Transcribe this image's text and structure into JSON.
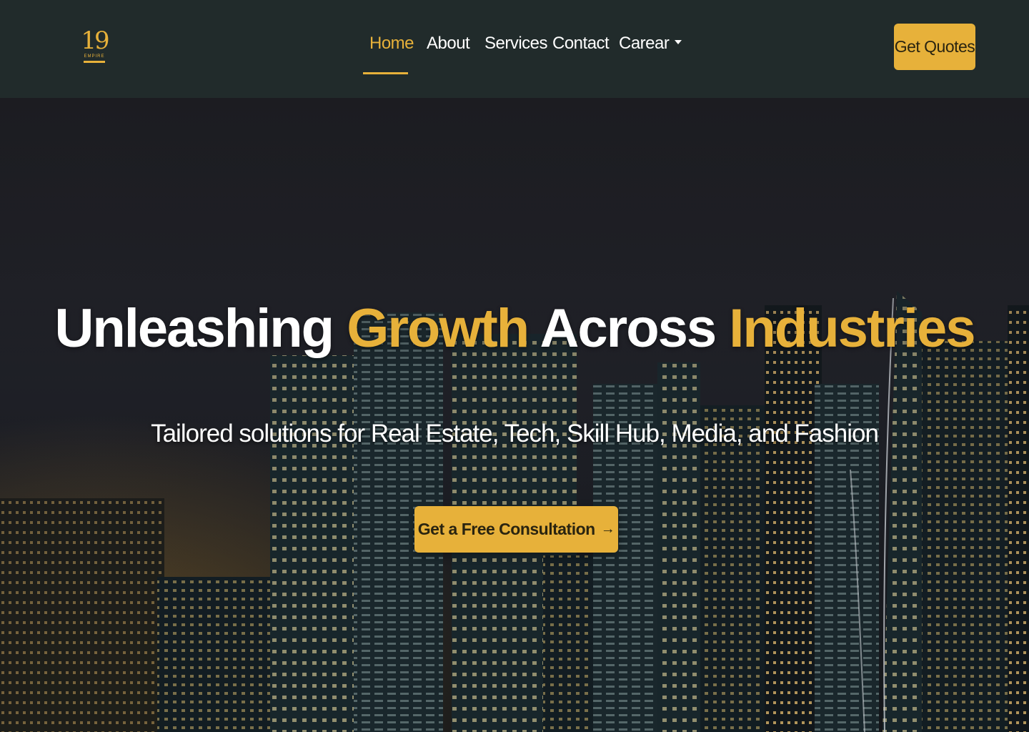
{
  "brand": {
    "logo_number": "19",
    "logo_word": "EMPIRE"
  },
  "nav": {
    "items": [
      {
        "label": "Home",
        "active": true
      },
      {
        "label": "About"
      },
      {
        "label": "Services"
      },
      {
        "label": "Contact"
      },
      {
        "label": "Carear",
        "has_dropdown": true
      }
    ],
    "quote_button": "Get Quotes"
  },
  "hero": {
    "title_parts": [
      "Unleashing ",
      "Growth",
      " Across ",
      "Industries"
    ],
    "subtitle": "Tailored solutions for Real Estate, Tech, Skill Hub, Media, and Fashion",
    "cta_label": "Get a Free Consultation",
    "cta_icon": "arrow-right-icon"
  },
  "colors": {
    "accent": "#e7b13a",
    "navbar_bg": "#212b2b",
    "text": "#ffffff"
  }
}
